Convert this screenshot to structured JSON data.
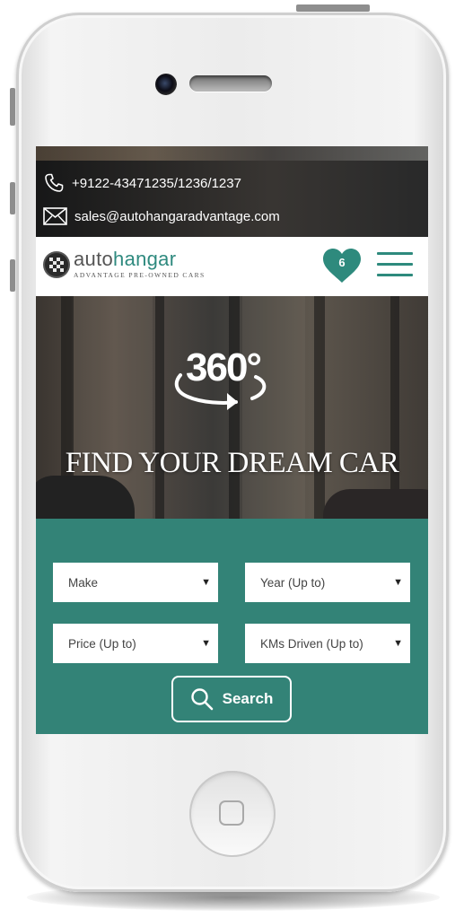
{
  "contact": {
    "phone": "+9122-43471235/1236/1237",
    "email": "sales@autohangaradvantage.com"
  },
  "brand": {
    "name_part1": "auto",
    "name_part2": "hangar",
    "tagline": "ADVANTAGE PRE-OWNED CARS"
  },
  "navbar": {
    "wishlist_count": "6",
    "icons": [
      "heart-icon",
      "hamburger-menu-icon"
    ]
  },
  "hero": {
    "badge": "360°",
    "title": "FIND YOUR DREAM CAR"
  },
  "search_form": {
    "make": "Make",
    "year": "Year (Up to)",
    "price": "Price (Up to)",
    "kms": "KMs Driven (Up to)",
    "button_label": "Search"
  },
  "colors": {
    "accent": "#338377",
    "accent_dark": "#2e8a7d"
  }
}
